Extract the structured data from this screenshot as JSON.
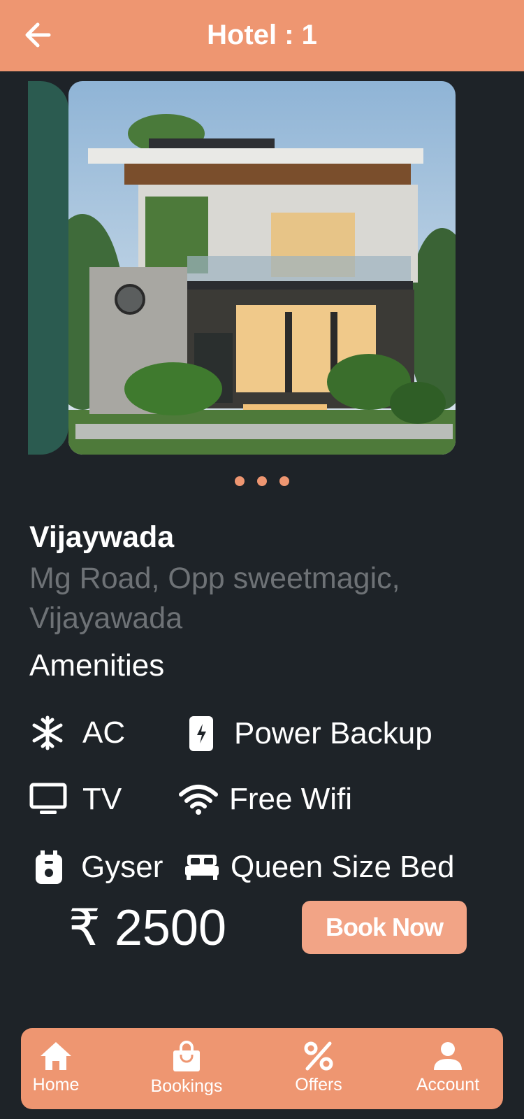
{
  "header": {
    "title": "Hotel : 1",
    "back_icon": "arrow-left-icon"
  },
  "carousel": {
    "image_label": "modern-villa-photo",
    "dot_count": 3
  },
  "hotel": {
    "city": "Vijaywada",
    "address": "Mg Road, Opp sweetmagic, Vijayawada"
  },
  "amenities": {
    "title": "Amenities",
    "items": [
      {
        "label": "AC",
        "icon": "snowflake-icon"
      },
      {
        "label": "Power Backup",
        "icon": "battery-phone-icon"
      },
      {
        "label": "TV",
        "icon": "tv-icon"
      },
      {
        "label": "Free Wifi",
        "icon": "wifi-icon"
      },
      {
        "label": "Gyser",
        "icon": "geyser-icon"
      },
      {
        "label": "Queen Size Bed",
        "icon": "bed-icon"
      }
    ]
  },
  "booking": {
    "price": "₹ 2500",
    "book_label": "Book Now"
  },
  "nav": {
    "items": [
      {
        "label": "Home",
        "icon": "home-icon"
      },
      {
        "label": "Bookings",
        "icon": "shopping-bag-icon"
      },
      {
        "label": "Offers",
        "icon": "percent-icon"
      },
      {
        "label": "Account",
        "icon": "person-icon"
      }
    ]
  },
  "colors": {
    "accent": "#ee9671",
    "background": "#1e2328",
    "muted_text": "#6e7276",
    "button": "#f2a486"
  }
}
